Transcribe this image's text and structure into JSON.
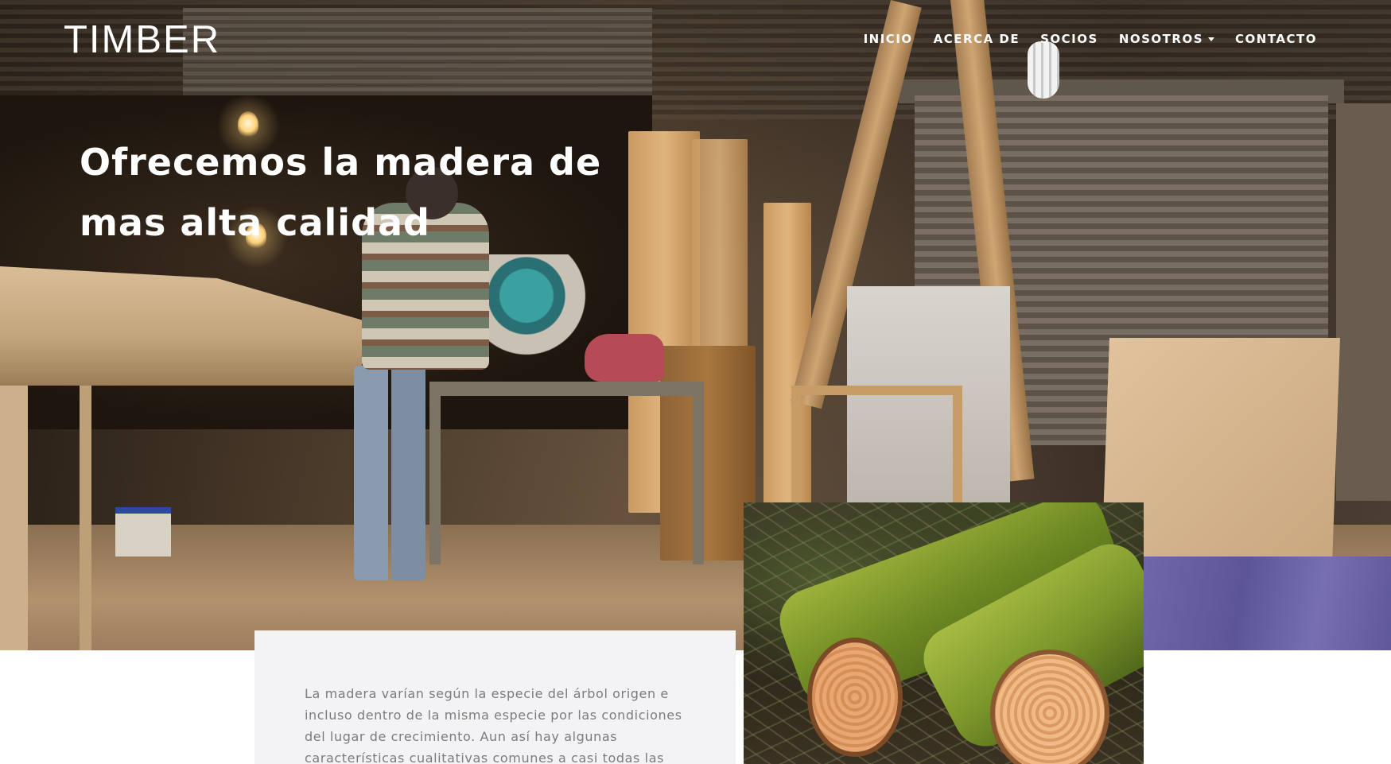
{
  "brand": {
    "name": "TIMBER"
  },
  "nav": {
    "items": [
      {
        "label": "INICIO"
      },
      {
        "label": "ACERCA DE"
      },
      {
        "label": "SOCIOS"
      },
      {
        "label": "NOSOTROS",
        "has_dropdown": true
      },
      {
        "label": "CONTACTO"
      }
    ]
  },
  "hero": {
    "title_line1": "Ofrecemos la madera de",
    "title_line2": "mas alta calidad"
  },
  "about": {
    "text": "La madera varían según la especie del árbol origen e incluso dentro de la misma especie por las condiciones del lugar de crecimiento. Aun así hay algunas características cualitativas comunes a casi todas las maderas."
  },
  "colors": {
    "nav_text": "#ffffff",
    "card_background": "#f3f3f6",
    "body_text": "#7b7b7b"
  }
}
